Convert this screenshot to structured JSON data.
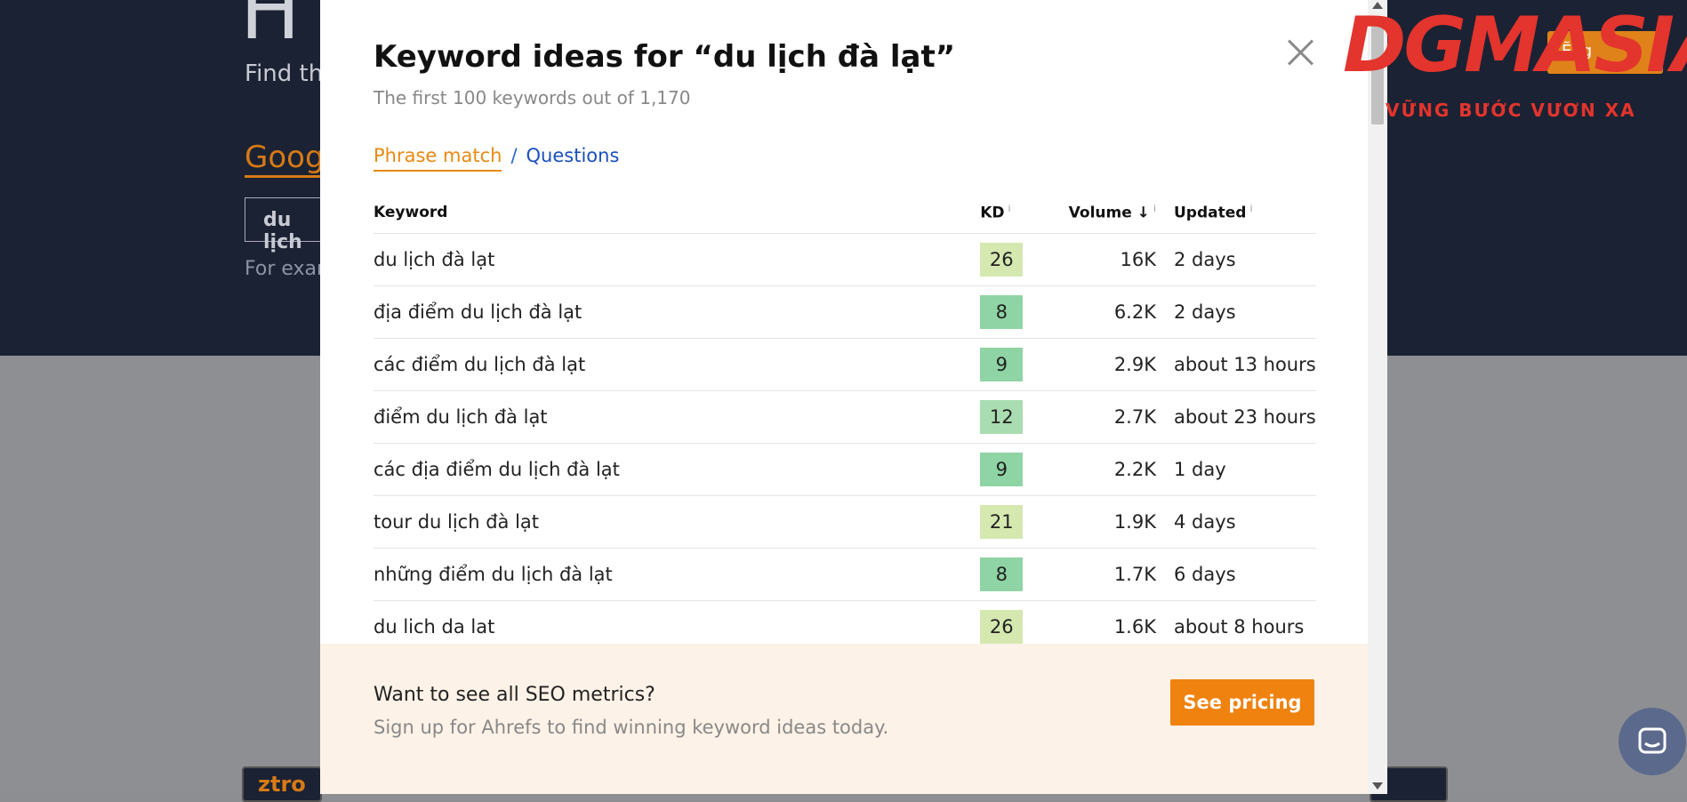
{
  "background": {
    "big_letter": "H",
    "subtitle": "Find th",
    "google_link": "Goog",
    "search_value": "du lịch",
    "example_text": "For exam",
    "bottom_card_left": "ztro",
    "bottom_card_right": "",
    "top_button": "Ẽng"
  },
  "logo": {
    "brand": "DGMASIA",
    "slogan": "VỮNG BƯỚC VƯƠN XA"
  },
  "modal": {
    "title": "Keyword ideas for “du lịch đà lạt”",
    "subtitle": "The first 100 keywords out of 1,170",
    "tabs": {
      "active": "Phrase match",
      "separator": "/",
      "other": "Questions"
    },
    "table": {
      "headers": {
        "keyword": "Keyword",
        "kd": "KD",
        "volume": "Volume",
        "volume_sort_arrow": "↓",
        "updated": "Updated",
        "info_mark": "i"
      },
      "rows": [
        {
          "keyword": "du lịch đà lạt",
          "kd": "26",
          "kd_color": "#d4e8b0",
          "volume": "16K",
          "updated": "2 days"
        },
        {
          "keyword": "địa điểm du lịch đà lạt",
          "kd": "8",
          "kd_color": "#8fd4a4",
          "volume": "6.2K",
          "updated": "2 days"
        },
        {
          "keyword": "các điểm du lịch đà lạt",
          "kd": "9",
          "kd_color": "#8fd4a4",
          "volume": "2.9K",
          "updated": "about 13 hours"
        },
        {
          "keyword": "điểm du lịch đà lạt",
          "kd": "12",
          "kd_color": "#a9dcb0",
          "volume": "2.7K",
          "updated": "about 23 hours"
        },
        {
          "keyword": "các địa điểm du lịch đà lạt",
          "kd": "9",
          "kd_color": "#8fd4a4",
          "volume": "2.2K",
          "updated": "1 day"
        },
        {
          "keyword": "tour du lịch đà lạt",
          "kd": "21",
          "kd_color": "#d4e8b0",
          "volume": "1.9K",
          "updated": "4 days"
        },
        {
          "keyword": "những điểm du lịch đà lạt",
          "kd": "8",
          "kd_color": "#8fd4a4",
          "volume": "1.7K",
          "updated": "6 days"
        },
        {
          "keyword": "du lich da lat",
          "kd": "26",
          "kd_color": "#d4e8b0",
          "volume": "1.6K",
          "updated": "about 8 hours"
        }
      ]
    },
    "promo": {
      "title": "Want to see all SEO metrics?",
      "text": "Sign up for Ahrefs to find winning keyword ideas today.",
      "button": "See pricing"
    }
  },
  "colors": {
    "accent_orange": "#f0820f",
    "link_blue": "#1a4fbd",
    "logo_red": "#e3342d",
    "promo_bg": "#fdf2e7"
  }
}
